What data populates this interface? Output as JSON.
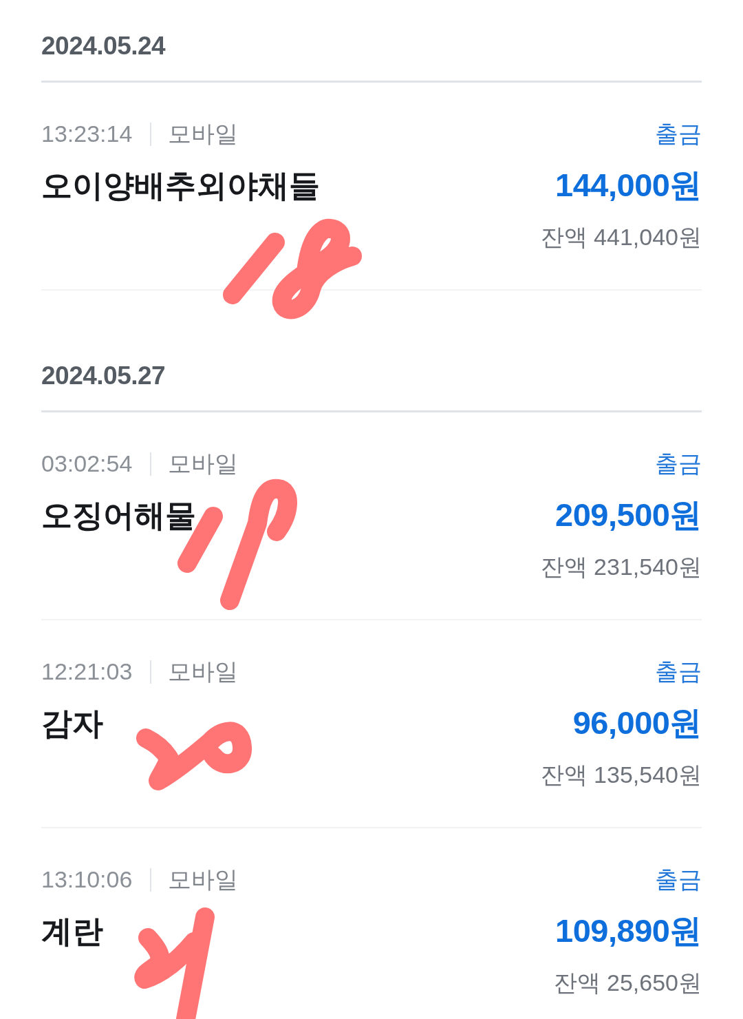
{
  "sections": [
    {
      "date": "2024.05.24",
      "transactions": [
        {
          "kind": "withdrawal",
          "time": "13:23:14",
          "channel": "모바일",
          "type": "출금",
          "description": "오이양배추외야채들",
          "amount": "144,000원",
          "balance": "잔액 441,040원"
        }
      ]
    },
    {
      "date": "2024.05.27",
      "transactions": [
        {
          "kind": "withdrawal",
          "time": "03:02:54",
          "channel": "모바일",
          "type": "출금",
          "description": "오징어해물",
          "amount": "209,500원",
          "balance": "잔액 231,540원"
        },
        {
          "kind": "withdrawal",
          "time": "12:21:03",
          "channel": "모바일",
          "type": "출금",
          "description": "감자",
          "amount": "96,000원",
          "balance": "잔액 135,540원"
        },
        {
          "kind": "withdrawal",
          "time": "13:10:06",
          "channel": "모바일",
          "type": "출금",
          "description": "계란",
          "amount": "109,890원",
          "balance": "잔액 25,650원"
        }
      ]
    }
  ]
}
